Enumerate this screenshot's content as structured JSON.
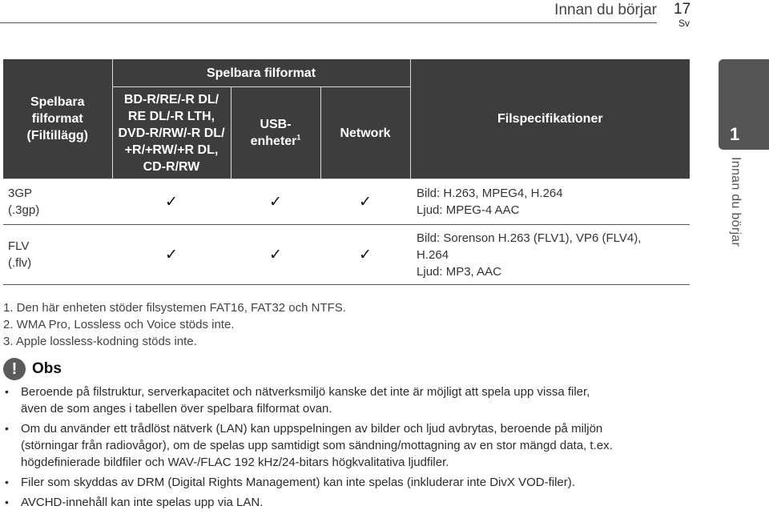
{
  "header": {
    "section_title": "Innan du börjar",
    "page_number": "17",
    "language": "Sv"
  },
  "side_tab": {
    "chapter_number": "1",
    "chapter_label": "Innan du börjar"
  },
  "table": {
    "col_format_header": [
      "Spelbara",
      "filformat",
      "(Filtillägg)"
    ],
    "group_header": "Spelbara filformat",
    "col_disc_header": [
      "BD-R/RE/-R DL/",
      "RE DL/-R LTH,",
      "DVD-R/RW/-R DL/",
      "+R/+RW/+R DL,",
      "CD-R/RW"
    ],
    "col_usb_header": [
      "USB-",
      "enheter"
    ],
    "col_usb_footnote": "1",
    "col_network_header": "Network",
    "col_spec_header": "Filspecifikationer",
    "check_glyph": "✓",
    "rows": [
      {
        "format": "3GP",
        "extension": "(.3gp)",
        "disc": true,
        "usb": true,
        "network": true,
        "spec": [
          "Bild: H.263, MPEG4, H.264",
          "Ljud: MPEG-4 AAC"
        ]
      },
      {
        "format": "FLV",
        "extension": "(.flv)",
        "disc": true,
        "usb": true,
        "network": true,
        "spec": [
          "Bild: Sorenson H.263 (FLV1), VP6 (FLV4),",
          "H.264",
          "Ljud: MP3, AAC"
        ]
      }
    ]
  },
  "footnotes": [
    "1. Den här enheten stöder filsystemen FAT16, FAT32 och NTFS.",
    "2. WMA Pro, Lossless och Voice stöds inte.",
    "3. Apple lossless-kodning stöds inte."
  ],
  "obs": {
    "icon_glyph": "!",
    "title": "Obs",
    "bullet_glyph": "•",
    "items": [
      [
        "Beroende på filstruktur, serverkapacitet och nätverksmiljö kanske det inte är möjligt att spela upp vissa filer,",
        "även de som anges i tabellen över spelbara filformat ovan."
      ],
      [
        "Om du använder ett trådlöst nätverk (LAN) kan uppspelningen av bilder och ljud avbrytas, beroende på miljön",
        "(störningar från radiovågor), om de spelas upp samtidigt som sändning/mottagning av en stor mängd data, t.ex.",
        "högdefinierade bildfiler och WAV-/FLAC 192 kHz/24-bitars högkvalitativa ljudfiler."
      ],
      [
        "Filer som skyddas av DRM (Digital Rights Management) kan inte spelas (inkluderar inte DivX VOD-filer)."
      ],
      [
        "AVCHD-innehåll kan inte spelas upp via LAN."
      ]
    ]
  },
  "colors": {
    "header_bg": "#3d3d3e",
    "tab_bg": "#545454",
    "icon_bg": "#5b5b5b"
  }
}
